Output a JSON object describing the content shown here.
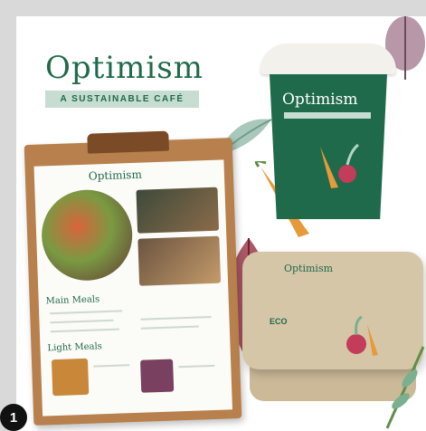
{
  "brand": {
    "name": "Optimism",
    "tagline": "A SUSTAINABLE CAFÉ"
  },
  "menu": {
    "logo": "Optimism",
    "section1": "Main Meals",
    "section2": "Light Meals"
  },
  "cup": {
    "name": "Optimism"
  },
  "box": {
    "name": "Optimism",
    "eco_label": "ECO"
  },
  "badge": {
    "number": "1"
  },
  "colors": {
    "brand_green": "#1f6a4a",
    "mint": "#c7ddd1",
    "kraft": "#d6c6a8",
    "wood": "#b7804c"
  }
}
